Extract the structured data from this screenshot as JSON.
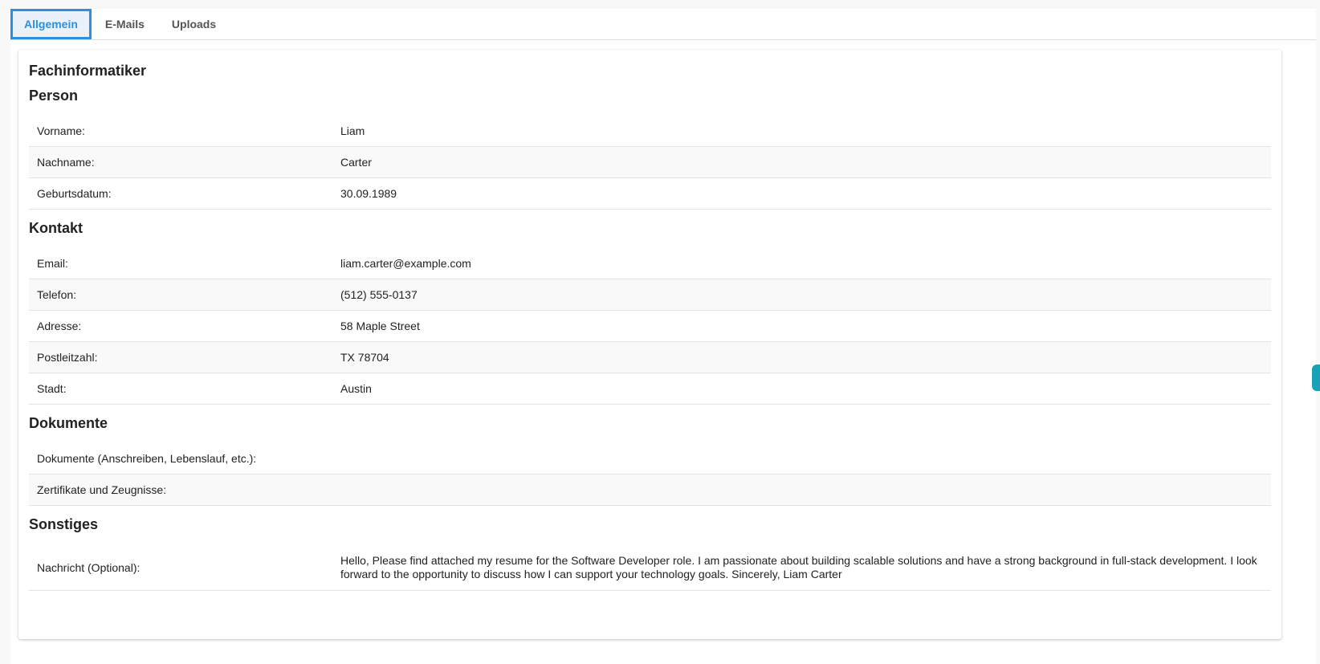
{
  "tabs": [
    {
      "label": "Allgemein",
      "active": true
    },
    {
      "label": "E-Mails",
      "active": false
    },
    {
      "label": "Uploads",
      "active": false
    }
  ],
  "card_title": "Fachinformatiker",
  "sections": {
    "person": {
      "title": "Person",
      "rows": [
        {
          "label": "Vorname:",
          "value": "Liam"
        },
        {
          "label": "Nachname:",
          "value": "Carter"
        },
        {
          "label": "Geburtsdatum:",
          "value": "30.09.1989"
        }
      ]
    },
    "kontakt": {
      "title": "Kontakt",
      "rows": [
        {
          "label": "Email:",
          "value": "liam.carter@example.com"
        },
        {
          "label": "Telefon:",
          "value": "(512) 555-0137"
        },
        {
          "label": "Adresse:",
          "value": "58 Maple Street"
        },
        {
          "label": "Postleitzahl:",
          "value": "TX 78704"
        },
        {
          "label": "Stadt:",
          "value": "Austin"
        }
      ]
    },
    "dokumente": {
      "title": "Dokumente",
      "rows": [
        {
          "label": "Dokumente (Anschreiben, Lebenslauf, etc.):",
          "value": ""
        },
        {
          "label": "Zertifikate und Zeugnisse:",
          "value": ""
        }
      ]
    },
    "sonstiges": {
      "title": "Sonstiges",
      "rows": [
        {
          "label": "Nachricht (Optional):",
          "value": "Hello, Please find attached my resume for the Software Developer role. I am passionate about building scalable solutions and have a strong background in full-stack development. I look forward to the opportunity to discuss how I can support your technology goals. Sincerely, Liam Carter"
        }
      ]
    }
  },
  "colors": {
    "accent": "#2d8fe0",
    "side_handle": "#17a2b8"
  }
}
